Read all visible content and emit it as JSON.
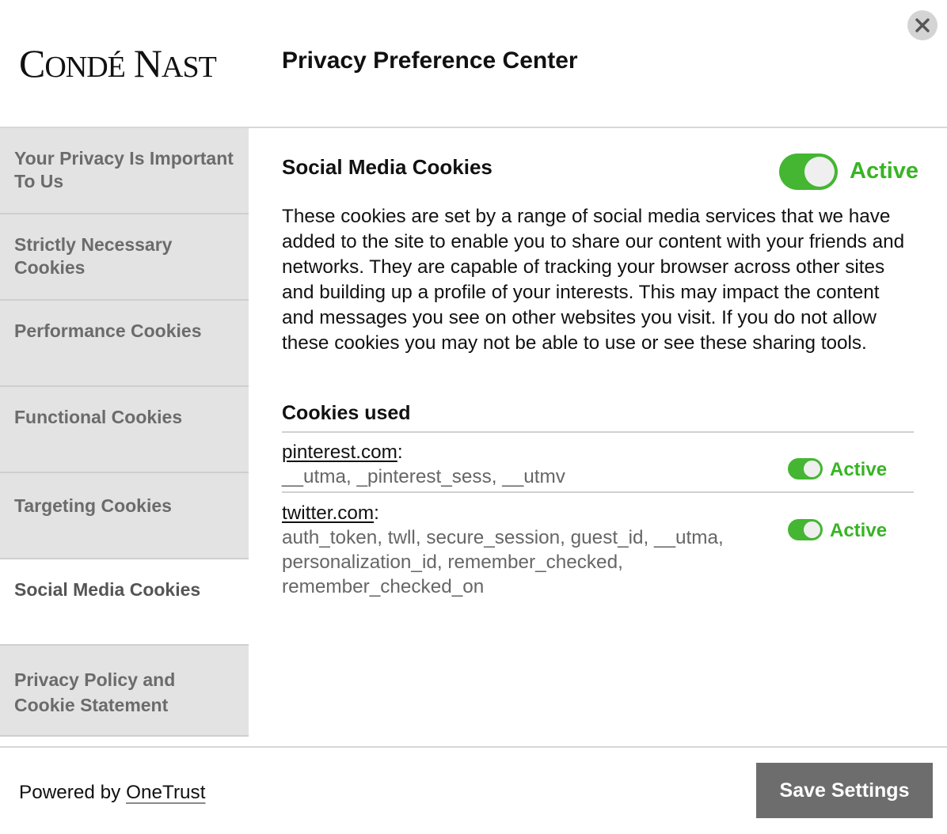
{
  "header": {
    "logo_text": "CONDÉ NAST",
    "title": "Privacy Preference Center",
    "close_icon": "close-icon"
  },
  "sidebar": {
    "items": [
      {
        "label": "Your Privacy Is Important To Us",
        "active": false
      },
      {
        "label": "Strictly Necessary Cookies",
        "active": false
      },
      {
        "label": "Performance Cookies",
        "active": false
      },
      {
        "label": "Functional Cookies",
        "active": false
      },
      {
        "label": "Targeting Cookies",
        "active": false
      },
      {
        "label": "Social Media Cookies",
        "active": true
      },
      {
        "label": "Privacy Policy and Cookie Statement",
        "active": false
      }
    ]
  },
  "main": {
    "section_title": "Social Media Cookies",
    "status_label": "Active",
    "description": "These cookies are set by a range of social media services that we have added to the site to enable you to share our content with your friends and networks. They are capable of tracking your browser across other sites and building up a profile of your interests. This may impact the content and messages you see on other websites you visit. If you do not allow these cookies you may not be able to use or see these sharing tools.",
    "cookies_used_heading": "Cookies used",
    "vendors": [
      {
        "domain": "pinterest.com",
        "cookies": "__utma, _pinterest_sess, __utmv",
        "status": "Active"
      },
      {
        "domain": "twitter.com",
        "cookies": "auth_token, twll, secure_session, guest_id, __utma, personalization_id, remember_checked, remember_checked_on",
        "status": "Active"
      }
    ]
  },
  "footer": {
    "powered_by": "Powered by",
    "powered_link": "OneTrust",
    "save_label": "Save Settings"
  },
  "colors": {
    "active_green": "#38b424",
    "toggle_green": "#44b632",
    "sidebar_bg": "#e3e3e3",
    "save_button_bg": "#6d6d6d"
  }
}
